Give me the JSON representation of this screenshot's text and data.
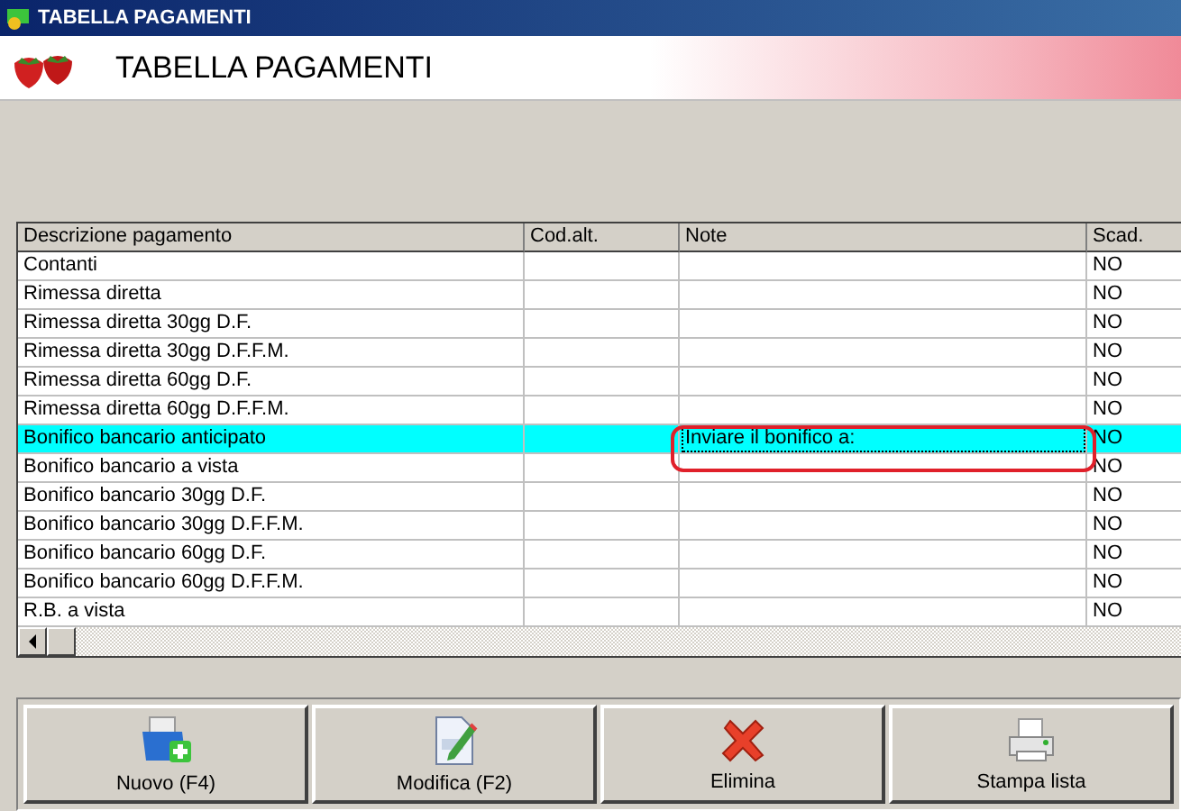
{
  "window": {
    "title": "TABELLA PAGAMENTI"
  },
  "header": {
    "title": "TABELLA PAGAMENTI"
  },
  "table": {
    "columns": [
      "Descrizione pagamento",
      "Cod.alt.",
      "Note",
      "Scad."
    ],
    "rows": [
      {
        "cells": [
          "Contanti",
          "",
          "",
          "NO"
        ],
        "selected": false
      },
      {
        "cells": [
          "Rimessa diretta",
          "",
          "",
          "NO"
        ],
        "selected": false
      },
      {
        "cells": [
          "Rimessa diretta 30gg D.F.",
          "",
          "",
          "NO"
        ],
        "selected": false
      },
      {
        "cells": [
          "Rimessa diretta 30gg D.F.F.M.",
          "",
          "",
          "NO"
        ],
        "selected": false
      },
      {
        "cells": [
          "Rimessa diretta 60gg D.F.",
          "",
          "",
          "NO"
        ],
        "selected": false
      },
      {
        "cells": [
          "Rimessa diretta 60gg D.F.F.M.",
          "",
          "",
          "NO"
        ],
        "selected": false
      },
      {
        "cells": [
          "Bonifico bancario anticipato",
          "",
          "Inviare il bonifico a:",
          "NO"
        ],
        "selected": true
      },
      {
        "cells": [
          "Bonifico bancario a vista",
          "",
          "",
          "NO"
        ],
        "selected": false
      },
      {
        "cells": [
          "Bonifico bancario 30gg D.F.",
          "",
          "",
          "NO"
        ],
        "selected": false
      },
      {
        "cells": [
          "Bonifico bancario 30gg D.F.F.M.",
          "",
          "",
          "NO"
        ],
        "selected": false
      },
      {
        "cells": [
          "Bonifico bancario 60gg D.F.",
          "",
          "",
          "NO"
        ],
        "selected": false
      },
      {
        "cells": [
          "Bonifico bancario 60gg D.F.F.M.",
          "",
          "",
          "NO"
        ],
        "selected": false
      },
      {
        "cells": [
          "R.B. a vista",
          "",
          "",
          "NO"
        ],
        "selected": false
      }
    ]
  },
  "buttons": [
    {
      "label": "Nuovo (F4)",
      "kind": "new"
    },
    {
      "label": "Modifica (F2)",
      "kind": "edit"
    },
    {
      "label": "Elimina",
      "kind": "delete"
    },
    {
      "label": "Stampa lista",
      "kind": "print"
    }
  ]
}
